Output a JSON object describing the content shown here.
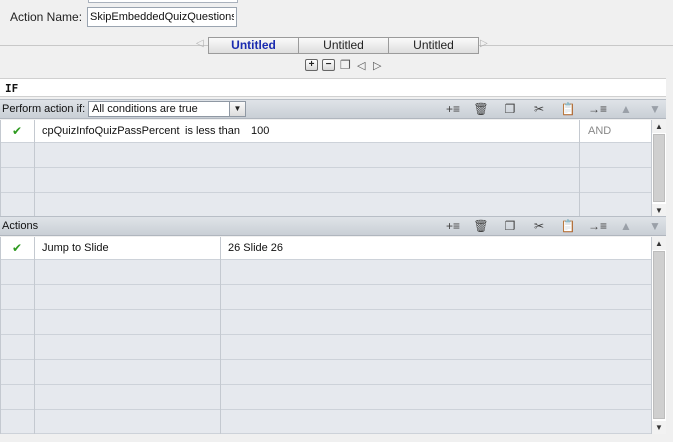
{
  "action_name": {
    "label": "Action Name:",
    "value": "SkipEmbeddedQuizQuestions"
  },
  "tabs": [
    {
      "label": "Untitled",
      "active": true
    },
    {
      "label": "Untitled",
      "active": false
    },
    {
      "label": "Untitled",
      "active": false
    }
  ],
  "tab_controls": {
    "add_icon": "plus-icon",
    "add_symbol": "+",
    "remove_icon": "minus-icon",
    "remove_symbol": "−",
    "copy_icon": "copy-icon",
    "copy_symbol": "❐",
    "prev_symbol": "◁",
    "next_symbol": "▷",
    "scroll_left_symbol": "◁",
    "scroll_right_symbol": "▷"
  },
  "if_label": "IF",
  "conditions_section": {
    "perform_label": "Perform action if:",
    "selected_option": "All conditions are true",
    "rows": [
      {
        "checked": true,
        "variable": "cpQuizInfoQuizPassPercent",
        "operator": "is less than",
        "value": "100",
        "logic": "AND"
      },
      {
        "checked": false,
        "variable": "",
        "operator": "",
        "value": "",
        "logic": ""
      },
      {
        "checked": false,
        "variable": "",
        "operator": "",
        "value": "",
        "logic": ""
      },
      {
        "checked": false,
        "variable": "",
        "operator": "",
        "value": "",
        "logic": ""
      }
    ]
  },
  "actions_section": {
    "label": "Actions",
    "rows": [
      {
        "checked": true,
        "action": "Jump to Slide",
        "target": "26 Slide 26"
      },
      {
        "checked": false,
        "action": "",
        "target": ""
      },
      {
        "checked": false,
        "action": "",
        "target": ""
      },
      {
        "checked": false,
        "action": "",
        "target": ""
      },
      {
        "checked": false,
        "action": "",
        "target": ""
      },
      {
        "checked": false,
        "action": "",
        "target": ""
      },
      {
        "checked": false,
        "action": "",
        "target": ""
      },
      {
        "checked": false,
        "action": "",
        "target": ""
      }
    ]
  },
  "toolbar": {
    "add_symbol": "+≡",
    "delete_symbol": "🗑",
    "copy_symbol": "❐",
    "cut_symbol": "✂",
    "paste_symbol": "📋",
    "insert_symbol": "→≡",
    "up_symbol": "▲",
    "down_symbol": "▼"
  },
  "check_symbol": "✔",
  "scroll": {
    "up_symbol": "▲",
    "down_symbol": "▼"
  }
}
